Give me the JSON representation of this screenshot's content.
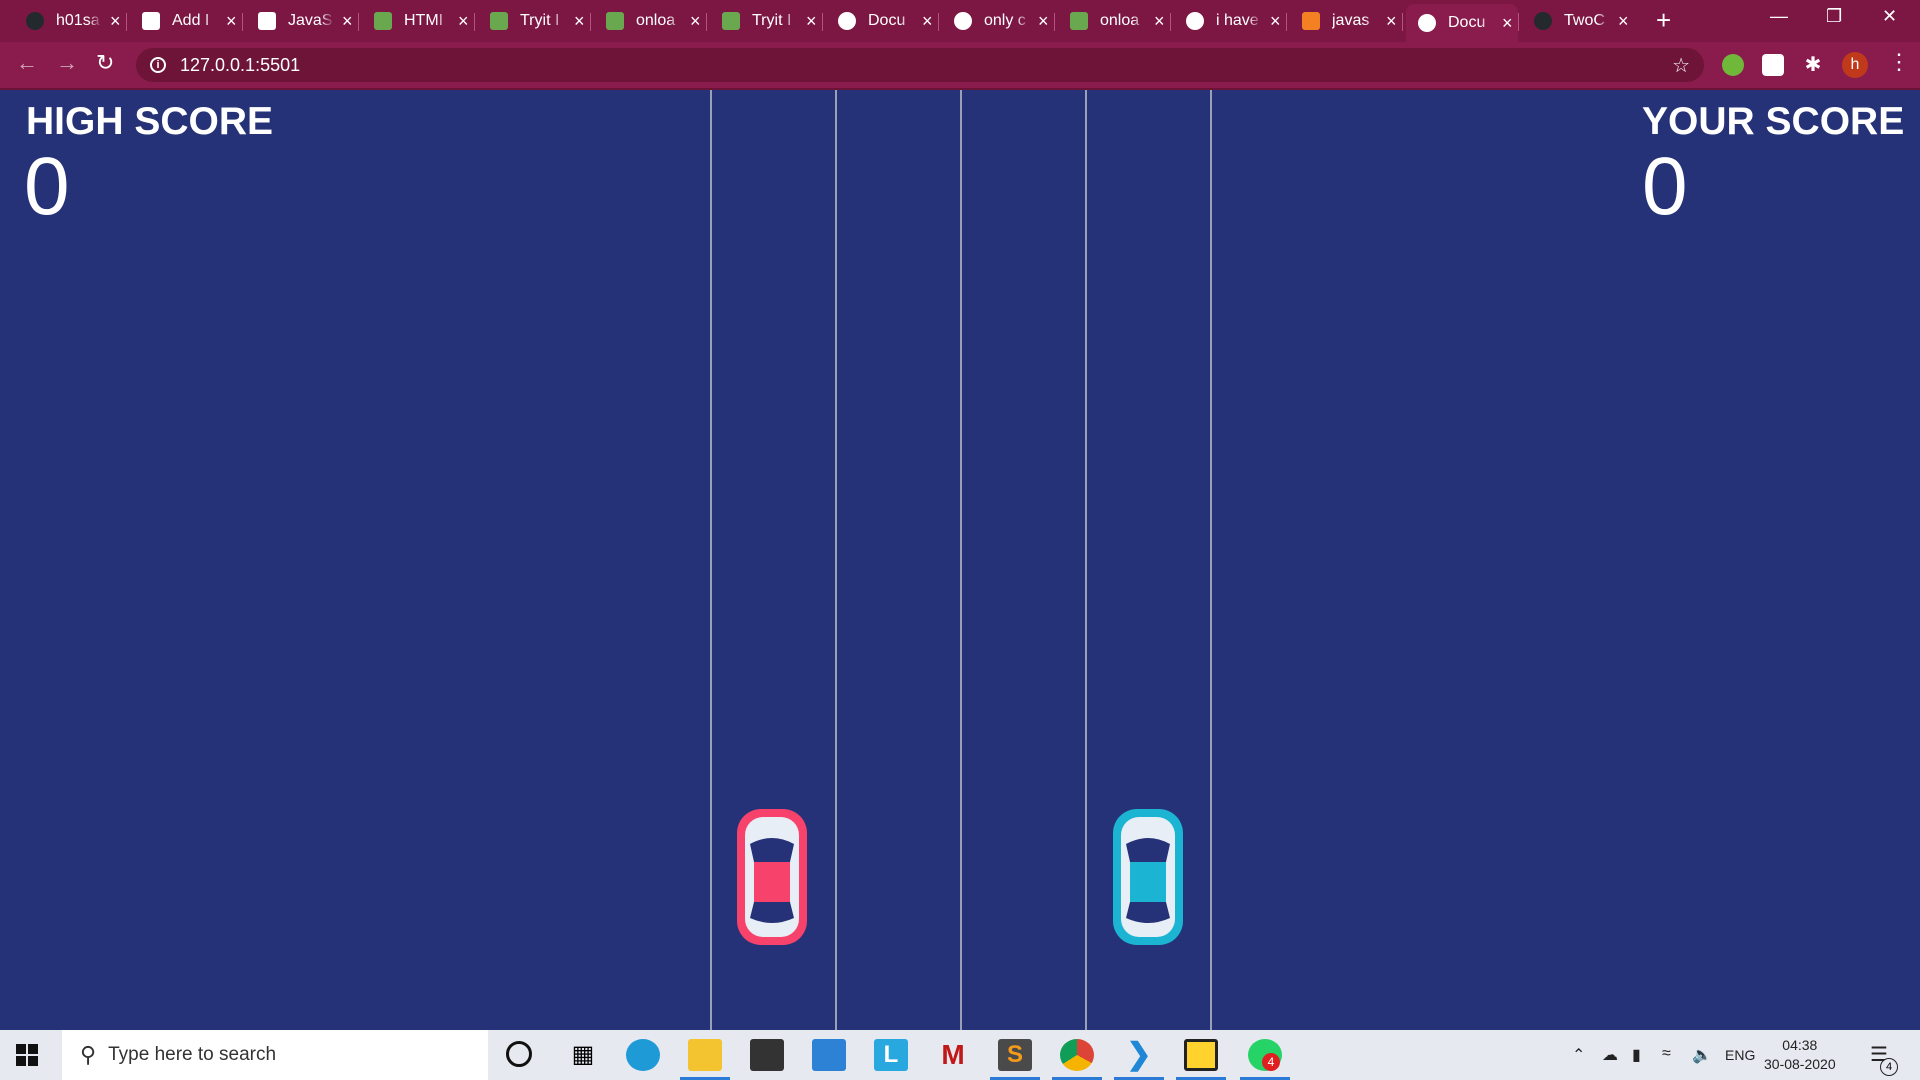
{
  "browser": {
    "tabs": [
      {
        "title": "h01sa",
        "favicon": "github-icon",
        "color": "#24292e"
      },
      {
        "title": "Add I",
        "favicon": "ed-icon",
        "color": "#ffffff"
      },
      {
        "title": "JavaS",
        "favicon": "tm-icon",
        "color": "#ffffff"
      },
      {
        "title": "HTMI",
        "favicon": "w3schools-icon",
        "color": "#6aa84f"
      },
      {
        "title": "Tryit I",
        "favicon": "w3schools-icon",
        "color": "#6aa84f"
      },
      {
        "title": "onloa",
        "favicon": "w3schools-icon",
        "color": "#6aa84f"
      },
      {
        "title": "Tryit I",
        "favicon": "w3schools-icon",
        "color": "#6aa84f"
      },
      {
        "title": "Docu",
        "favicon": "globe-icon",
        "color": "#ffffff"
      },
      {
        "title": "only c",
        "favicon": "google-icon",
        "color": "#ffffff"
      },
      {
        "title": "onloa",
        "favicon": "w3schools-icon",
        "color": "#6aa84f"
      },
      {
        "title": "i have",
        "favicon": "google-icon",
        "color": "#ffffff"
      },
      {
        "title": "javas",
        "favicon": "stackoverflow-icon",
        "color": "#f48024"
      },
      {
        "title": "Docu",
        "favicon": "globe-icon",
        "color": "#ffffff",
        "active": true
      },
      {
        "title": "TwoC",
        "favicon": "github-icon",
        "color": "#24292e"
      }
    ],
    "url": "127.0.0.1:5501",
    "profile_initial": "h"
  },
  "game": {
    "high_score_label": "HIGH SCORE",
    "high_score_value": "0",
    "your_score_label": "YOUR SCORE",
    "your_score_value": "0",
    "colors": {
      "background": "#263277",
      "red_car": "#f7426b",
      "blue_car": "#1bb4d2",
      "lane": "#9aa0b8"
    }
  },
  "taskbar": {
    "search_placeholder": "Type here to search",
    "language": "ENG",
    "time": "04:38",
    "date": "30-08-2020",
    "notifications": "4",
    "whatsapp_badge": "4"
  }
}
